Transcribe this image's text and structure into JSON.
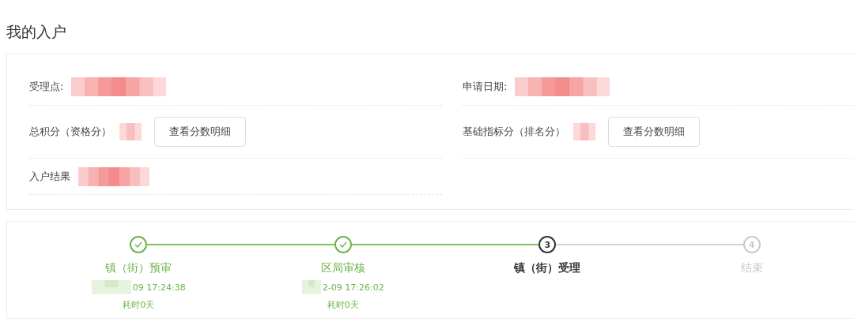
{
  "title": "我的入户",
  "info": [
    {
      "label": "受理点:",
      "kind": "text"
    },
    {
      "label": "申请日期:",
      "kind": "text"
    },
    {
      "label": "总积分（资格分）",
      "kind": "score",
      "button": "查看分数明细"
    },
    {
      "label": "基础指标分（排名分）",
      "kind": "score",
      "button": "查看分数明细"
    },
    {
      "label": "入户结果",
      "kind": "text"
    }
  ],
  "steps": [
    {
      "title": "镇（街）预审",
      "kind": "done",
      "time": "09 17:24:38",
      "duration": "耗时0天"
    },
    {
      "title": "区局审核",
      "kind": "done",
      "time": "2-09 17:26:02",
      "duration": "耗时0天"
    },
    {
      "number": "3",
      "title": "镇（街）受理",
      "kind": "current"
    },
    {
      "number": "4",
      "title": "结束",
      "kind": "pending"
    }
  ]
}
